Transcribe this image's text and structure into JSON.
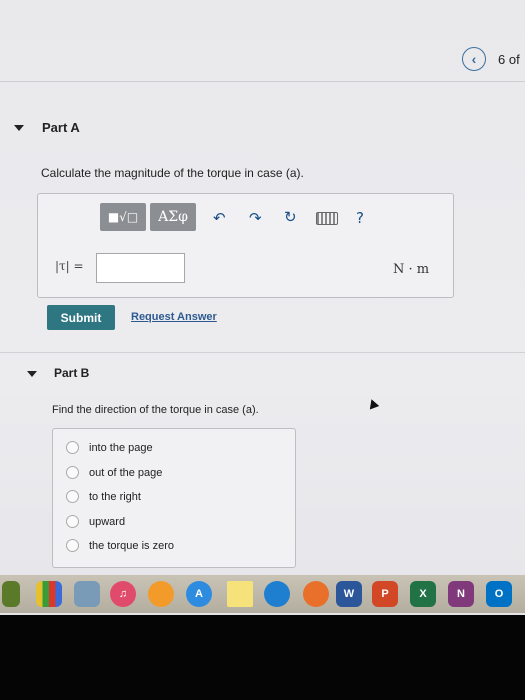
{
  "header": {
    "pager_text": "6 of"
  },
  "part_a": {
    "title": "Part A",
    "prompt": "Calculate the magnitude of the torque in case (a).",
    "toolbar": {
      "template_label": "■√□",
      "greek_label": "ΑΣφ",
      "help_label": "?"
    },
    "variable_label": "|τ| =",
    "answer_value": "",
    "units": "N · m",
    "submit_label": "Submit",
    "request_label": "Request Answer"
  },
  "part_b": {
    "title": "Part B",
    "prompt": "Find the direction of the torque in case (a).",
    "options": [
      {
        "label": "into the page",
        "selected": false
      },
      {
        "label": "out of the page",
        "selected": false
      },
      {
        "label": "to the right",
        "selected": false
      },
      {
        "label": "upward",
        "selected": false
      },
      {
        "label": "the torque is zero",
        "selected": false
      }
    ]
  },
  "dock": {
    "word_label": "W",
    "powerpoint_label": "P",
    "excel_label": "X",
    "onenote_label": "N",
    "outlook_label": "O"
  },
  "colors": {
    "submit": "#2f7683",
    "link": "#2d5b91",
    "toolbar_button": "#8b8e92"
  },
  "icons": [
    "chevron-left-icon",
    "undo-icon",
    "redo-icon",
    "reset-icon",
    "keyboard-icon"
  ]
}
